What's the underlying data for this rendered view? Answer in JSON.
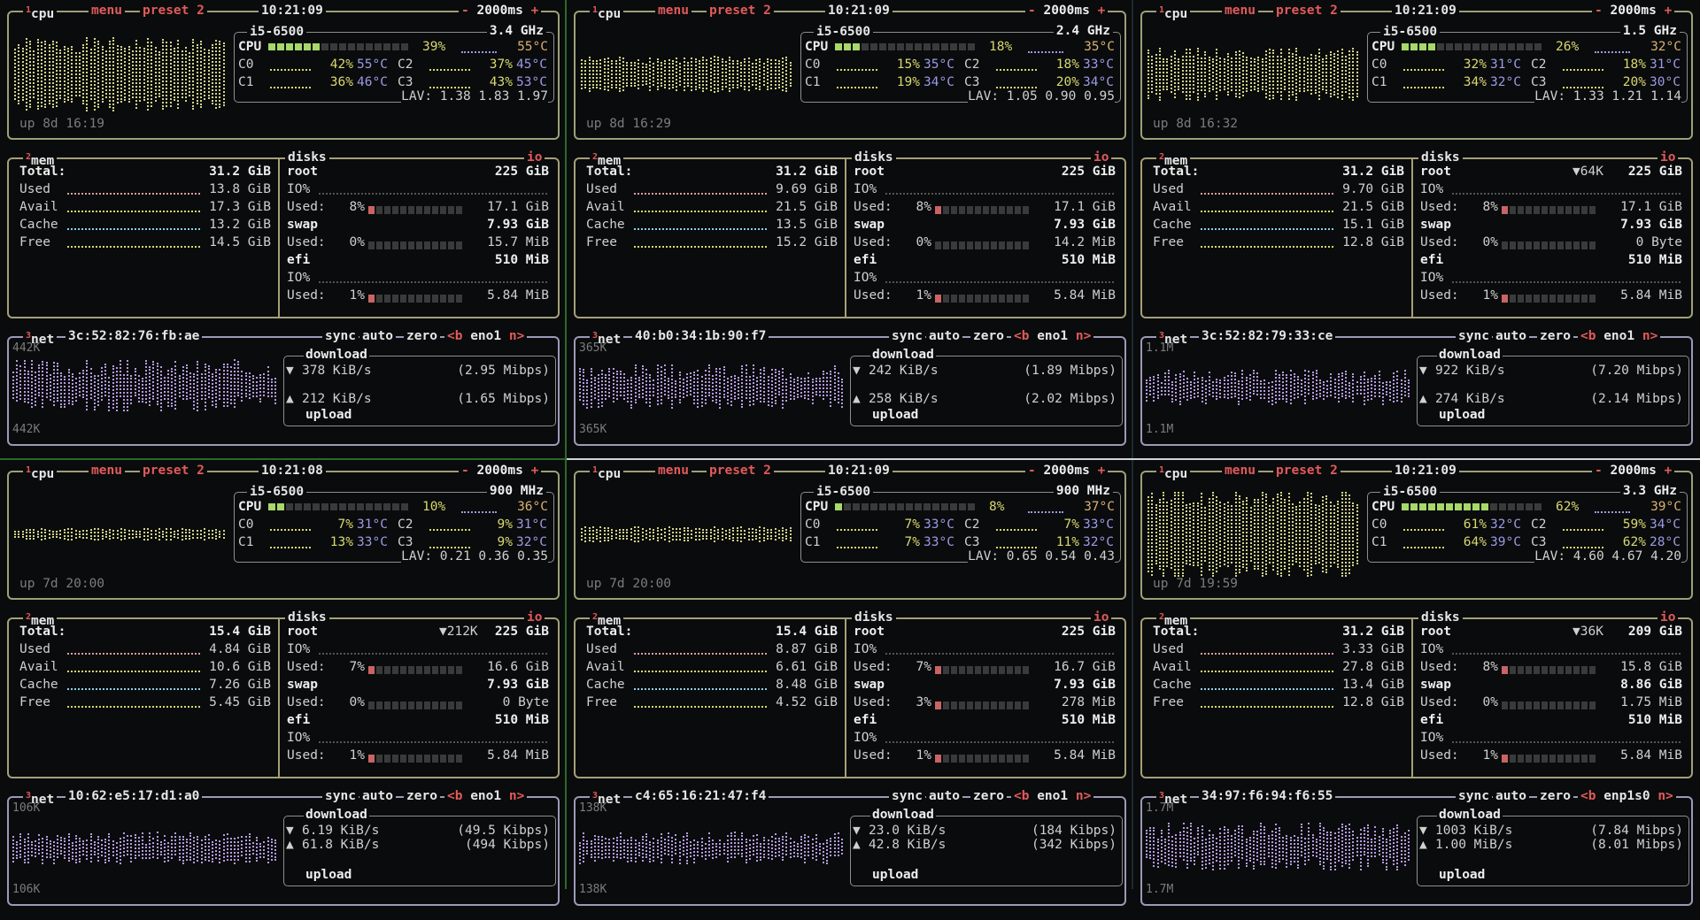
{
  "tabs": {
    "cpu": "cpu",
    "menu": "menu",
    "preset": "preset 2",
    "mem": "mem",
    "disks": "disks",
    "io": "io",
    "net": "net",
    "sync": "sync",
    "auto": "auto",
    "zero": "zero",
    "prev_if": "<b",
    "next_if": "n>",
    "minus": "-",
    "plus": "+",
    "sup_cpu": "1",
    "sup_mem": "2",
    "sup_net": "3"
  },
  "labels": {
    "cpu": "CPU",
    "lav": "LAV:",
    "total": "Total:",
    "used": "Used",
    "avail": "Avail",
    "cache": "Cache",
    "free": "Free",
    "io": "IO%",
    "used_colon": "Used:",
    "download": "download",
    "upload": "upload",
    "down_arrow": "▼",
    "up_arrow": "▲"
  },
  "colors": {
    "accent_red": "#e25a5a",
    "cpu_graph": "#d2d48a",
    "mem_used": "#d8a0a0",
    "mem_avail": "#d8d870",
    "mem_cache": "#8ad0e8",
    "mem_free": "#d8d870",
    "net_graph": "#b49be0",
    "disk_bar": "#c86464",
    "temp_blue": "#9a9ae6",
    "temp_pink": "#e6a0c8",
    "border_cpu": "#9ea078",
    "border_net": "#9f98b8"
  },
  "panes": [
    {
      "time": "10:21:09",
      "interval": "2000ms",
      "uptime": "up 8d 16:19",
      "cpu_name": "i5-6500",
      "freq": "3.4 GHz",
      "cpu_pct": "39%",
      "cpu_fill": 0.39,
      "cpu_temp": "55°C",
      "cores": [
        {
          "name": "C0",
          "pct": "42%",
          "temp": "55°C"
        },
        {
          "name": "C1",
          "pct": "36%",
          "temp": "46°C"
        },
        {
          "name": "C2",
          "pct": "37%",
          "temp": "45°C"
        },
        {
          "name": "C3",
          "pct": "43%",
          "temp": "53°C"
        }
      ],
      "lav": "1.38 1.83 1.97",
      "mem_total": "31.2 GiB",
      "mem_used": "13.8 GiB",
      "mem_avail": "17.3 GiB",
      "mem_cache": "13.2 GiB",
      "mem_free": "14.5 GiB",
      "mem_used_fill": 0.44,
      "mem_avail_fill": 0.56,
      "mem_cache_fill": 0.42,
      "mem_free_fill": 0.46,
      "root_io": "",
      "root_size": "225 GiB",
      "root_used_pct": "8%",
      "root_used_fill": 0.08,
      "root_used": "17.1 GiB",
      "swap_size": "7.93 GiB",
      "swap_used_pct": "0%",
      "swap_used_fill": 0.0,
      "swap_used": "15.7 MiB",
      "efi_size": "510 MiB",
      "efi_used_pct": "1%",
      "efi_used_fill": 0.01,
      "efi_used": "5.84 MiB",
      "mac": "3c:52:82:76:fb:ae",
      "iface": "eno1",
      "scale_top": "442K",
      "scale_bottom": "442K",
      "down": "378 KiB/s",
      "down_mbps": "(2.95 Mibps)",
      "up": "212 KiB/s",
      "up_mbps": "(1.65 Mibps)",
      "cpu_level": 0.7,
      "net_level": 0.65
    },
    {
      "time": "10:21:09",
      "interval": "2000ms",
      "uptime": "up 8d 16:29",
      "cpu_name": "i5-6500",
      "freq": "2.4 GHz",
      "cpu_pct": "18%",
      "cpu_fill": 0.18,
      "cpu_temp": "35°C",
      "cores": [
        {
          "name": "C0",
          "pct": "15%",
          "temp": "35°C"
        },
        {
          "name": "C1",
          "pct": "19%",
          "temp": "34°C"
        },
        {
          "name": "C2",
          "pct": "18%",
          "temp": "33°C"
        },
        {
          "name": "C3",
          "pct": "20%",
          "temp": "34°C"
        }
      ],
      "lav": "1.05 0.90 0.95",
      "mem_total": "31.2 GiB",
      "mem_used": "9.69 GiB",
      "mem_avail": "21.5 GiB",
      "mem_cache": "13.5 GiB",
      "mem_free": "15.2 GiB",
      "mem_used_fill": 0.31,
      "mem_avail_fill": 0.69,
      "mem_cache_fill": 0.43,
      "mem_free_fill": 0.49,
      "root_io": "",
      "root_size": "225 GiB",
      "root_used_pct": "8%",
      "root_used_fill": 0.08,
      "root_used": "17.1 GiB",
      "swap_size": "7.93 GiB",
      "swap_used_pct": "0%",
      "swap_used_fill": 0.0,
      "swap_used": "14.2 MiB",
      "efi_size": "510 MiB",
      "efi_used_pct": "1%",
      "efi_used_fill": 0.01,
      "efi_used": "5.84 MiB",
      "mac": "40:b0:34:1b:90:f7",
      "iface": "eno1",
      "scale_top": "365K",
      "scale_bottom": "365K",
      "down": "242 KiB/s",
      "down_mbps": "(1.89 Mibps)",
      "up": "258 KiB/s",
      "up_mbps": "(2.02 Mibps)",
      "cpu_level": 0.35,
      "net_level": 0.55
    },
    {
      "time": "10:21:09",
      "interval": "2000ms",
      "uptime": "up 8d 16:32",
      "cpu_name": "i5-6500",
      "freq": "1.5 GHz",
      "cpu_pct": "26%",
      "cpu_fill": 0.26,
      "cpu_temp": "32°C",
      "cores": [
        {
          "name": "C0",
          "pct": "32%",
          "temp": "31°C"
        },
        {
          "name": "C1",
          "pct": "34%",
          "temp": "32°C"
        },
        {
          "name": "C2",
          "pct": "18%",
          "temp": "31°C"
        },
        {
          "name": "C3",
          "pct": "20%",
          "temp": "30°C"
        }
      ],
      "lav": "1.33 1.21 1.14",
      "mem_total": "31.2 GiB",
      "mem_used": "9.70 GiB",
      "mem_avail": "21.5 GiB",
      "mem_cache": "15.1 GiB",
      "mem_free": "12.8 GiB",
      "mem_used_fill": 0.31,
      "mem_avail_fill": 0.69,
      "mem_cache_fill": 0.48,
      "mem_free_fill": 0.41,
      "root_io": "▼64K",
      "root_size": "225 GiB",
      "root_used_pct": "8%",
      "root_used_fill": 0.08,
      "root_used": "17.1 GiB",
      "swap_size": "7.93 GiB",
      "swap_used_pct": "0%",
      "swap_used_fill": 0.0,
      "swap_used": "0 Byte",
      "efi_size": "510 MiB",
      "efi_used_pct": "1%",
      "efi_used_fill": 0.01,
      "efi_used": "5.84 MiB",
      "mac": "3c:52:82:79:33:ce",
      "iface": "eno1",
      "scale_top": "1.1M",
      "scale_bottom": "1.1M",
      "down": "922 KiB/s",
      "down_mbps": "(7.20 Mibps)",
      "up": "274 KiB/s",
      "up_mbps": "(2.14 Mibps)",
      "cpu_level": 0.5,
      "net_level": 0.45
    },
    {
      "time": "10:21:08",
      "interval": "2000ms",
      "uptime": "up 7d 20:00",
      "cpu_name": "i5-6500",
      "freq": "900 MHz",
      "cpu_pct": "10%",
      "cpu_fill": 0.1,
      "cpu_temp": "36°C",
      "cores": [
        {
          "name": "C0",
          "pct": "7%",
          "temp": "31°C"
        },
        {
          "name": "C1",
          "pct": "13%",
          "temp": "33°C"
        },
        {
          "name": "C2",
          "pct": "9%",
          "temp": "31°C"
        },
        {
          "name": "C3",
          "pct": "9%",
          "temp": "32°C"
        }
      ],
      "lav": "0.21 0.36 0.35",
      "mem_total": "15.4 GiB",
      "mem_used": "4.84 GiB",
      "mem_avail": "10.6 GiB",
      "mem_cache": "7.26 GiB",
      "mem_free": "5.45 GiB",
      "mem_used_fill": 0.31,
      "mem_avail_fill": 0.69,
      "mem_cache_fill": 0.47,
      "mem_free_fill": 0.35,
      "root_io": "▼212K",
      "root_size": "225 GiB",
      "root_used_pct": "7%",
      "root_used_fill": 0.07,
      "root_used": "16.6 GiB",
      "swap_size": "7.93 GiB",
      "swap_used_pct": "0%",
      "swap_used_fill": 0.0,
      "swap_used": "0 Byte",
      "efi_size": "510 MiB",
      "efi_used_pct": "1%",
      "efi_used_fill": 0.01,
      "efi_used": "5.84 MiB",
      "mac": "10:62:e5:17:d1:a0",
      "iface": "eno1",
      "scale_top": "106K",
      "scale_bottom": "106K",
      "down": "6.19 KiB/s",
      "down_mbps": "(49.5 Kibps)",
      "up": "61.8 KiB/s",
      "up_mbps": "(494 Kibps)",
      "cpu_level": 0.12,
      "net_level": 0.4
    },
    {
      "time": "10:21:09",
      "interval": "2000ms",
      "uptime": "up 7d 20:00",
      "cpu_name": "i5-6500",
      "freq": "900 MHz",
      "cpu_pct": "8%",
      "cpu_fill": 0.08,
      "cpu_temp": "37°C",
      "cores": [
        {
          "name": "C0",
          "pct": "7%",
          "temp": "33°C"
        },
        {
          "name": "C1",
          "pct": "7%",
          "temp": "33°C"
        },
        {
          "name": "C2",
          "pct": "7%",
          "temp": "33°C"
        },
        {
          "name": "C3",
          "pct": "11%",
          "temp": "32°C"
        }
      ],
      "lav": "0.65 0.54 0.43",
      "mem_total": "15.4 GiB",
      "mem_used": "8.87 GiB",
      "mem_avail": "6.61 GiB",
      "mem_cache": "8.48 GiB",
      "mem_free": "4.52 GiB",
      "mem_used_fill": 0.58,
      "mem_avail_fill": 0.43,
      "mem_cache_fill": 0.55,
      "mem_free_fill": 0.29,
      "root_io": "",
      "root_size": "225 GiB",
      "root_used_pct": "7%",
      "root_used_fill": 0.07,
      "root_used": "16.7 GiB",
      "swap_size": "7.93 GiB",
      "swap_used_pct": "3%",
      "swap_used_fill": 0.03,
      "swap_used": "278 MiB",
      "efi_size": "510 MiB",
      "efi_used_pct": "1%",
      "efi_used_fill": 0.01,
      "efi_used": "5.84 MiB",
      "mac": "c4:65:16:21:47:f4",
      "iface": "eno1",
      "scale_top": "138K",
      "scale_bottom": "138K",
      "down": "23.0 KiB/s",
      "down_mbps": "(184 Kibps)",
      "up": "42.8 KiB/s",
      "up_mbps": "(342 Kibps)",
      "cpu_level": 0.15,
      "net_level": 0.4
    },
    {
      "time": "10:21:09",
      "interval": "2000ms",
      "uptime": "up 7d 19:59",
      "cpu_name": "i5-6500",
      "freq": "3.3 GHz",
      "cpu_pct": "62%",
      "cpu_fill": 0.62,
      "cpu_temp": "39°C",
      "cores": [
        {
          "name": "C0",
          "pct": "61%",
          "temp": "32°C"
        },
        {
          "name": "C1",
          "pct": "64%",
          "temp": "39°C"
        },
        {
          "name": "C2",
          "pct": "59%",
          "temp": "34°C"
        },
        {
          "name": "C3",
          "pct": "62%",
          "temp": "28°C"
        }
      ],
      "lav": "4.60 4.67 4.20",
      "mem_total": "31.2 GiB",
      "mem_used": "3.33 GiB",
      "mem_avail": "27.8 GiB",
      "mem_cache": "13.4 GiB",
      "mem_free": "12.8 GiB",
      "mem_used_fill": 0.11,
      "mem_avail_fill": 0.89,
      "mem_cache_fill": 0.43,
      "mem_free_fill": 0.41,
      "root_io": "▼36K",
      "root_size": "209 GiB",
      "root_used_pct": "8%",
      "root_used_fill": 0.08,
      "root_used": "15.8 GiB",
      "swap_size": "8.86 GiB",
      "swap_used_pct": "0%",
      "swap_used_fill": 0.0,
      "swap_used": "1.75 MiB",
      "efi_size": "510 MiB",
      "efi_used_pct": "1%",
      "efi_used_fill": 0.01,
      "efi_used": "5.84 MiB",
      "mac": "34:97:f6:94:f6:55",
      "iface": "enp1s0",
      "scale_top": "1.7M",
      "scale_bottom": "1.7M",
      "down": "1003 KiB/s",
      "down_mbps": "(7.84 Mibps)",
      "up": "1.00 MiB/s",
      "up_mbps": "(8.01 Mibps)",
      "cpu_level": 0.85,
      "net_level": 0.6
    }
  ]
}
